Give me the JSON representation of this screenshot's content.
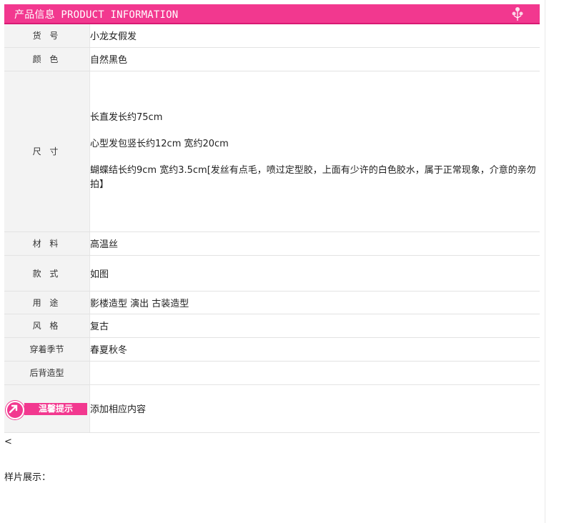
{
  "banner": {
    "title": "产品信息 PRODUCT INFORMATION",
    "decoration_icon": "flower-stamp-icon"
  },
  "rows": {
    "item_no": {
      "label": "货 号",
      "value": "小龙女假发"
    },
    "color": {
      "label": "颜 色",
      "value": "自然黑色"
    },
    "size": {
      "label": "尺 寸",
      "lines": [
        "长直发长约75cm",
        "心型发包竖长约12cm  宽约20cm",
        "蝴蝶结长约9cm 宽约3.5cm[发丝有点毛，喷过定型胶，上面有少许的白色胶水，属于正常现象，介意的亲勿拍】"
      ]
    },
    "material": {
      "label": "材 料",
      "value": "高温丝"
    },
    "style": {
      "label": "款 式",
      "value": "如图"
    },
    "usage": {
      "label": "用 途",
      "value": "影楼造型  演出  古装造型"
    },
    "look": {
      "label": "风 格",
      "value": "复古"
    },
    "season": {
      "label": "穿着季节",
      "value": "春夏秋冬"
    },
    "back_style": {
      "label": "后背造型",
      "value": ""
    },
    "tip": {
      "badge_text": "温馨提示",
      "value": "添加相应内容"
    }
  },
  "footer": {
    "prev_link": "<",
    "sample_label": "样片展示："
  },
  "colors": {
    "accent": "#f2388f",
    "label_bg": "#f3f3f3"
  }
}
